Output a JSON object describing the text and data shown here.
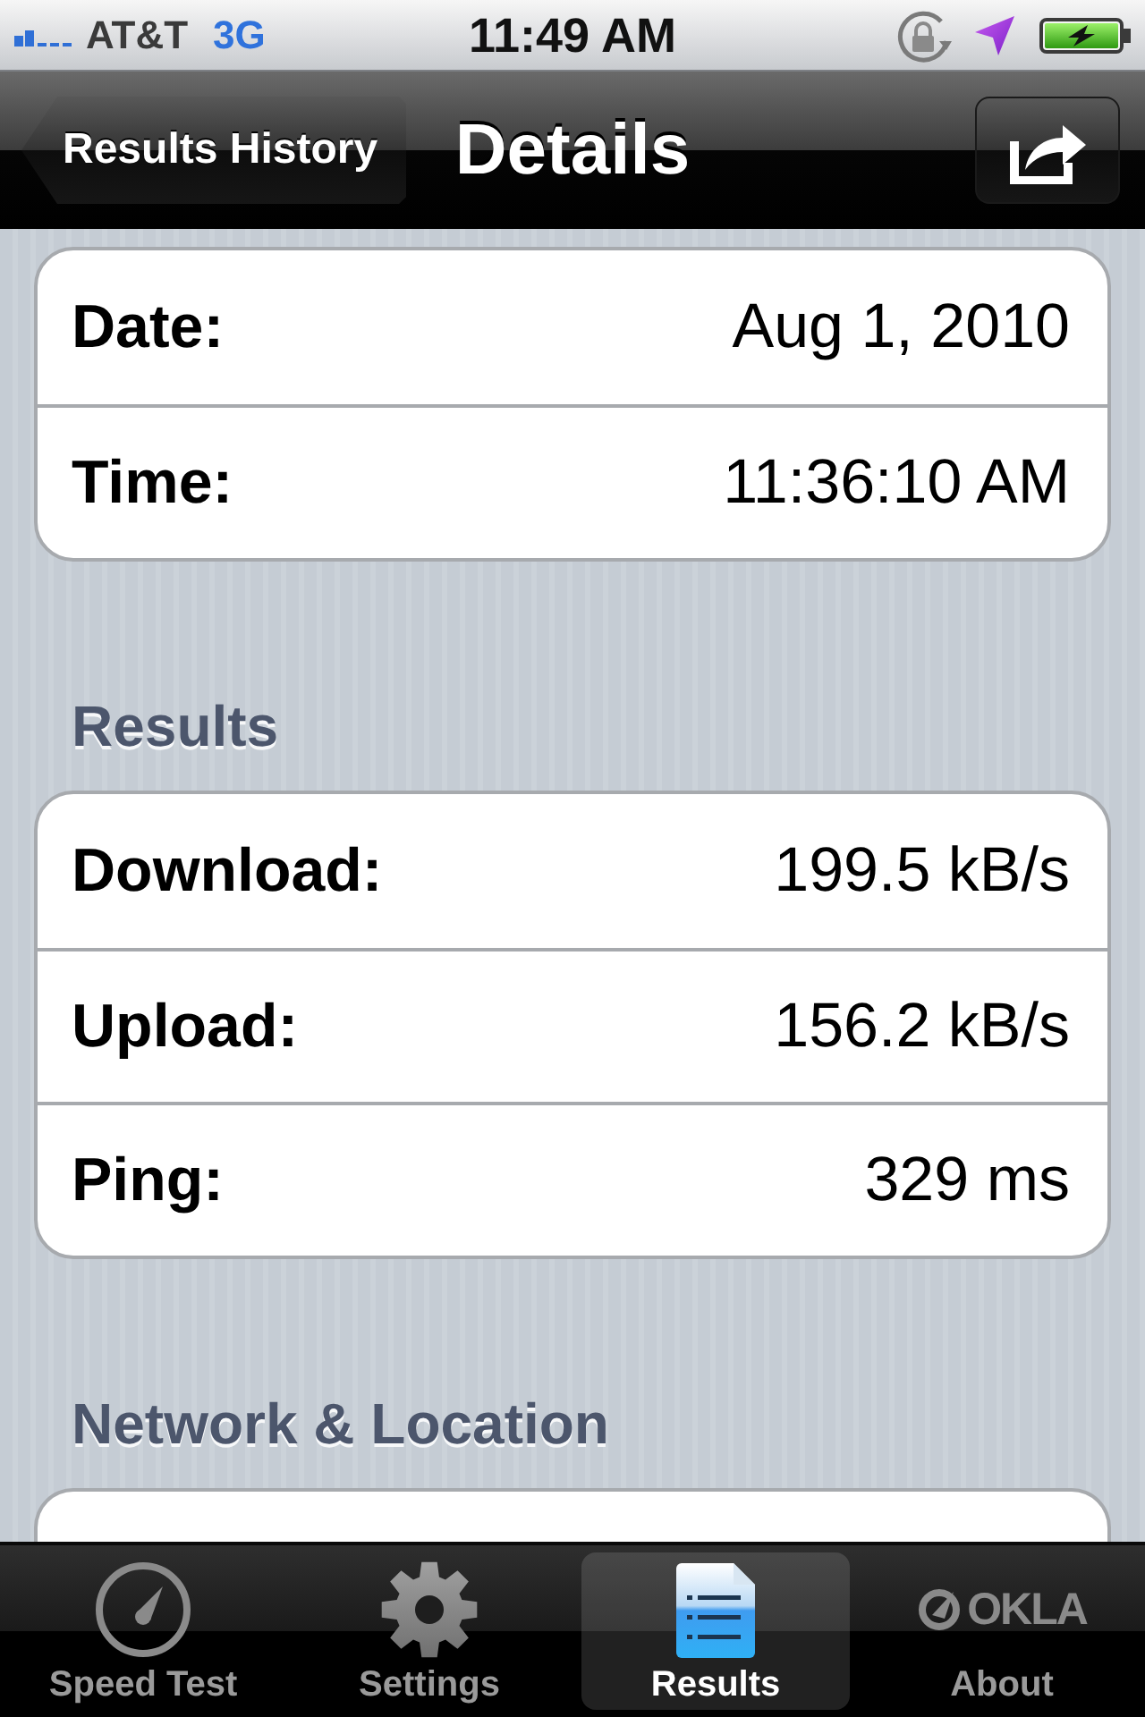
{
  "status_bar": {
    "carrier": "AT&T",
    "network": "3G",
    "time": "11:49 AM"
  },
  "nav_bar": {
    "back_button": "Results History",
    "title": "Details"
  },
  "sections": [
    {
      "rows": [
        {
          "label": "Date:",
          "value": "Aug 1, 2010"
        },
        {
          "label": "Time:",
          "value": "11:36:10 AM"
        }
      ]
    },
    {
      "header": "Results",
      "rows": [
        {
          "label": "Download:",
          "value": "199.5 kB/s"
        },
        {
          "label": "Upload:",
          "value": "156.2 kB/s"
        },
        {
          "label": "Ping:",
          "value": "329 ms"
        }
      ]
    },
    {
      "header": "Network & Location"
    }
  ],
  "tab_bar": {
    "tabs": [
      {
        "label": "Speed Test",
        "selected": false
      },
      {
        "label": "Settings",
        "selected": false
      },
      {
        "label": "Results",
        "selected": true
      },
      {
        "label": "About",
        "selected": false,
        "logo": "OKLA"
      }
    ]
  }
}
